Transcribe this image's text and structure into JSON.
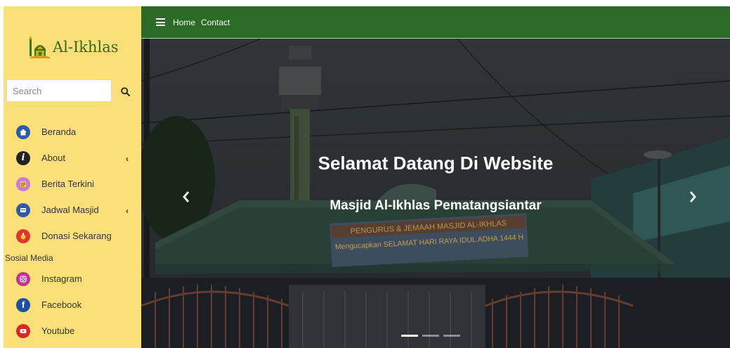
{
  "brand": {
    "name": "Al-Ikhlas",
    "logo_icon": "mosque-logo-icon",
    "colors": {
      "sidebar": "#fbe07a",
      "header": "#2c6b26",
      "logo_text": "#2f6b1e"
    }
  },
  "search": {
    "placeholder": "Search",
    "icon": "search-icon"
  },
  "sidebar": {
    "items": [
      {
        "label": "Beranda",
        "icon": "home-icon",
        "color": "#2e5aa8",
        "chevron": false
      },
      {
        "label": "About",
        "icon": "info-icon",
        "color": "#222222",
        "chevron": true
      },
      {
        "label": "Berita Terkini",
        "icon": "news-icon",
        "color": "#c97ad6",
        "chevron": false
      },
      {
        "label": "Jadwal Masjid",
        "icon": "schedule-icon",
        "color": "#2e5aa8",
        "chevron": true
      },
      {
        "label": "Donasi Sekarang",
        "icon": "donation-icon",
        "color": "#e0352b",
        "chevron": false
      }
    ],
    "section_label": "Sosial Media",
    "social": [
      {
        "label": "Instagram",
        "icon": "instagram-icon",
        "color": "#c1358f"
      },
      {
        "label": "Facebook",
        "icon": "facebook-icon",
        "color": "#1f4fa0"
      },
      {
        "label": "Youtube",
        "icon": "youtube-icon",
        "color": "#e02424"
      }
    ]
  },
  "topnav": {
    "menu_icon": "hamburger-icon",
    "links": [
      "Home",
      "Contact"
    ]
  },
  "hero": {
    "title": "Selamat Datang Di Website",
    "subtitle": "Masjid Al-Ikhlas Pematangsiantar",
    "banner_line1": "PENGURUS & JEMAAH MASJID AL-IKHLAS",
    "banner_line2": "Mengucapkan SELAMAT HARI RAYA IDUL ADHA 1444 H",
    "prev_icon": "chevron-left-icon",
    "next_icon": "chevron-right-icon",
    "slide_count": 3,
    "active_slide": 1
  }
}
